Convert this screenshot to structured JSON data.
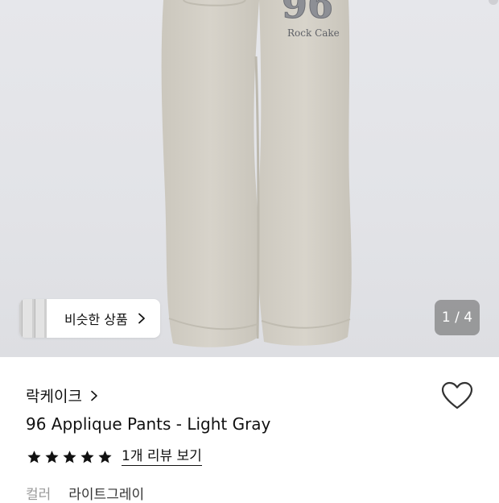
{
  "hero": {
    "print_text": "Rock Cake",
    "print_number": "96",
    "similar_button_label": "비슷한 상품",
    "image_counter": "1 / 4"
  },
  "product": {
    "brand": "락케이크",
    "title": "96 Applique Pants - Light Gray",
    "rating_stars": 5,
    "review_link": "1개 리뷰 보기",
    "option_label": "컬러",
    "option_value": "라이트그레이"
  },
  "colors": {
    "background": "#ffffff",
    "pants": "#d4d0c6",
    "counter_bg": "#5f5f5f",
    "star": "#111111"
  },
  "icons": [
    "chevron-right-icon",
    "heart-icon",
    "star-icon"
  ]
}
